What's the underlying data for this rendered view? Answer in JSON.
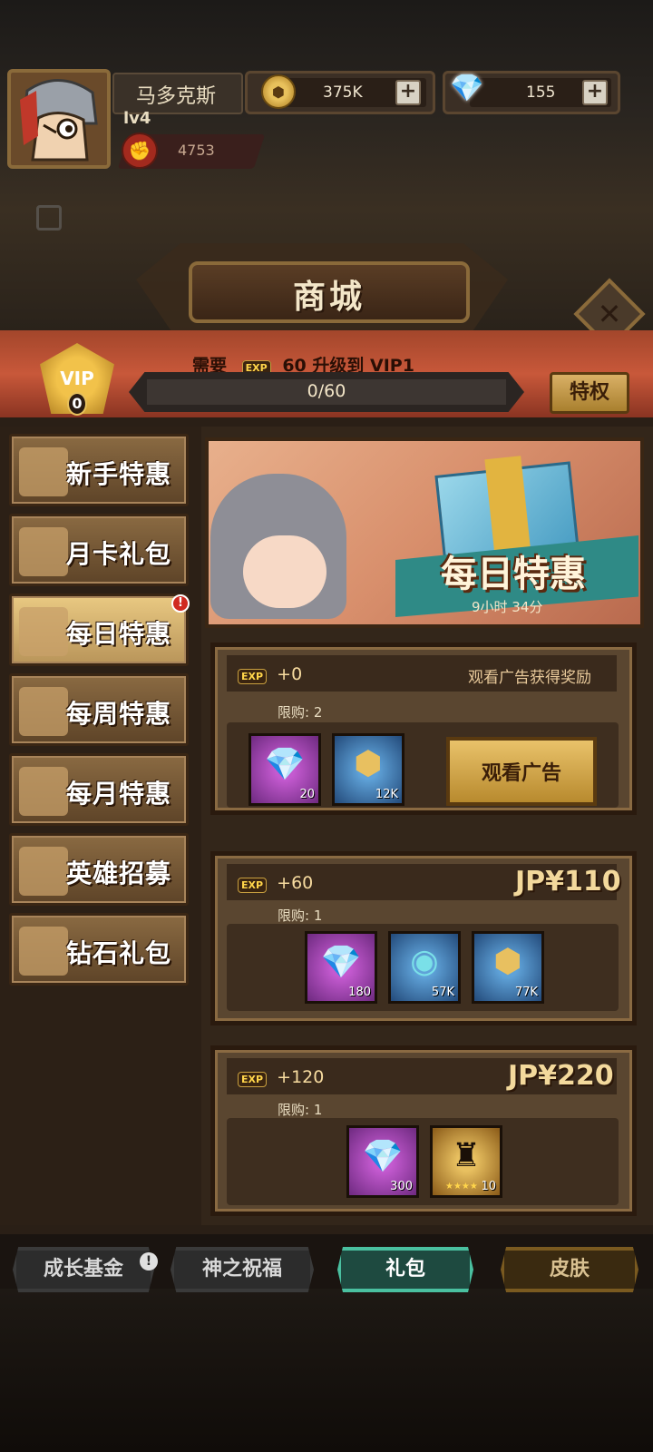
{
  "player": {
    "name": "马多克斯",
    "level": "lv4",
    "power": "4753"
  },
  "resources": {
    "gold": "375K",
    "diamonds": "155",
    "plus": "+"
  },
  "title": "商城",
  "close": "✕",
  "vip": {
    "badge": "VIP",
    "level": "0",
    "need_label": "需要",
    "exp_icon": "EXP",
    "need_text": "60 升级到 VIP1",
    "progress_text": "0/60",
    "progress": 0,
    "privilege_button": "特权"
  },
  "menu": [
    {
      "label": "新手特惠",
      "active": false
    },
    {
      "label": "月卡礼包",
      "active": false
    },
    {
      "label": "每日特惠",
      "active": true,
      "alert": "!"
    },
    {
      "label": "每周特惠",
      "active": false
    },
    {
      "label": "每月特惠",
      "active": false
    },
    {
      "label": "英雄招募",
      "active": false
    },
    {
      "label": "钻石礼包",
      "active": false
    }
  ],
  "banner": {
    "title": "每日特惠",
    "timer": "9小时 34分"
  },
  "packages": [
    {
      "exp_icon": "EXP",
      "exp": "+0",
      "right_text": "观看广告获得奖励",
      "limit": "限购: 2",
      "items": [
        {
          "type": "diamond",
          "count": "20"
        },
        {
          "type": "gold-coin",
          "count": "12K"
        }
      ],
      "button": "观看广告"
    },
    {
      "exp_icon": "EXP",
      "exp": "+60",
      "price": "JP¥110",
      "limit": "限购: 1",
      "items": [
        {
          "type": "diamond",
          "count": "180"
        },
        {
          "type": "hero-essence",
          "count": "57K"
        },
        {
          "type": "gold-coin",
          "count": "77K"
        }
      ]
    },
    {
      "exp_icon": "EXP",
      "exp": "+120",
      "price": "JP¥220",
      "limit": "限购: 1",
      "items": [
        {
          "type": "diamond",
          "count": "300"
        },
        {
          "type": "demon-mask",
          "count": "10",
          "stars": 4
        }
      ]
    }
  ],
  "tabs": [
    {
      "label": "成长基金",
      "alert": "!"
    },
    {
      "label": "神之祝福"
    },
    {
      "label": "礼包",
      "active": true
    },
    {
      "label": "皮肤"
    }
  ],
  "colors": {
    "vip_strip": "#c8583a",
    "active_tab": "#4ac0a0",
    "alert_dot": "#d02a20"
  }
}
